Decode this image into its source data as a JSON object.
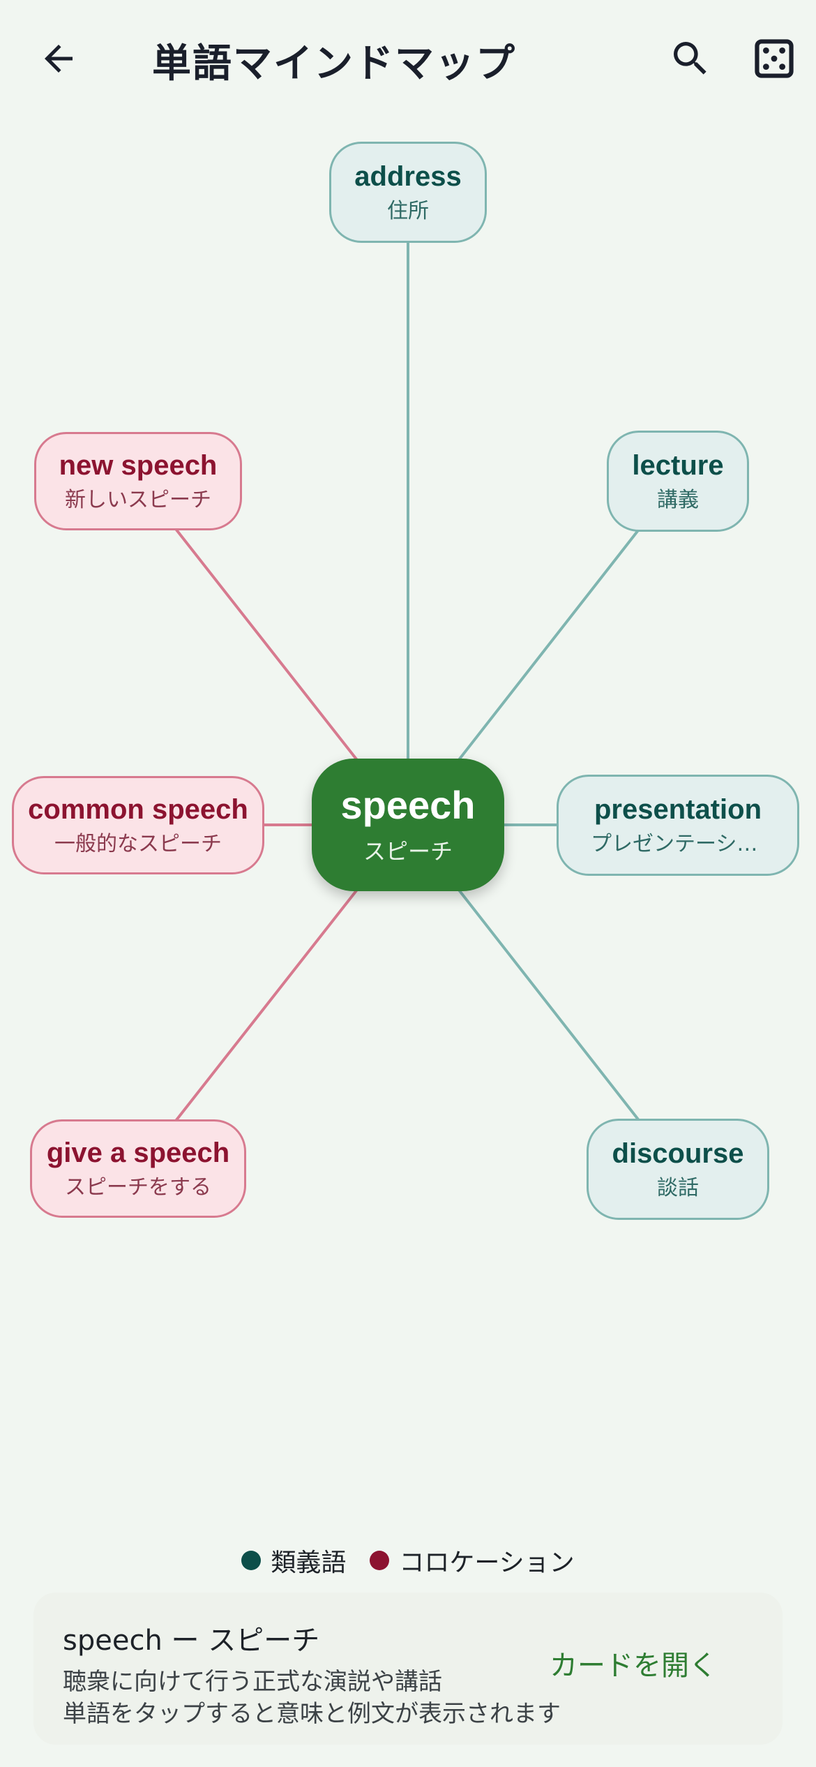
{
  "header": {
    "title": "単語マインドマップ",
    "back_icon": "arrow-left-icon",
    "search_icon": "search-icon",
    "dice_icon": "dice-icon"
  },
  "center": {
    "word": "speech",
    "meaning": "スピーチ",
    "color": "#2e7d32"
  },
  "synonyms": [
    {
      "word": "address",
      "meaning": "住所"
    },
    {
      "word": "lecture",
      "meaning": "講義"
    },
    {
      "word": "presentation",
      "meaning": "プレゼンテーション"
    },
    {
      "word": "discourse",
      "meaning": "談話"
    }
  ],
  "collocations": [
    {
      "word": "new speech",
      "meaning": "新しいスピーチ"
    },
    {
      "word": "common speech",
      "meaning": "一般的なスピーチ"
    },
    {
      "word": "give a speech",
      "meaning": "スピーチをする"
    }
  ],
  "legend": {
    "synonym_label": "類義語",
    "collocation_label": "コロケーション",
    "synonym_color": "#0d4f4a",
    "collocation_color": "#8c1330"
  },
  "info": {
    "title": "speech ー スピーチ",
    "description": "聴衆に向けて行う正式な演説や講話",
    "hint": "単語をタップすると意味と例文が表示されます",
    "open_card_label": "カードを開く"
  }
}
